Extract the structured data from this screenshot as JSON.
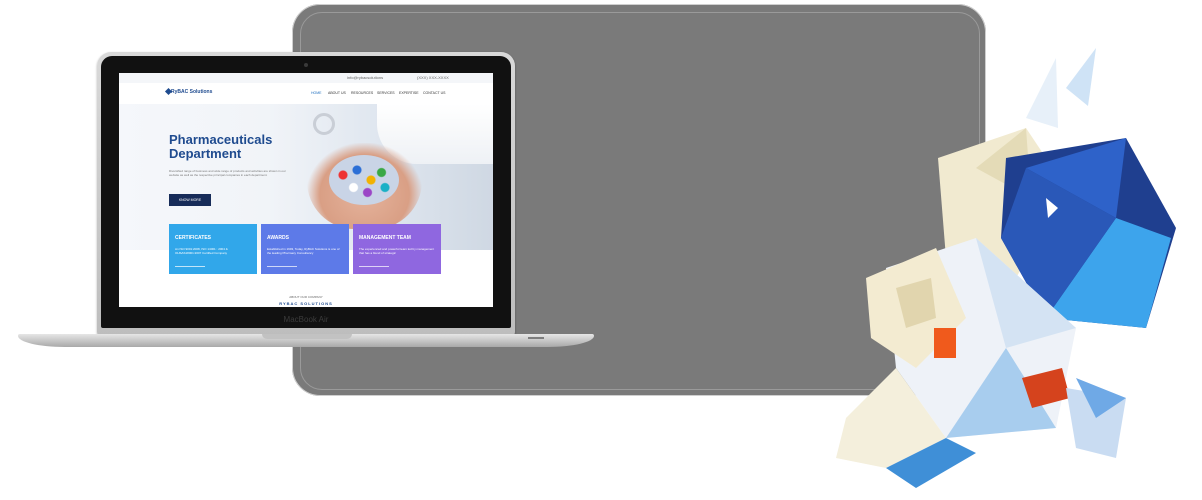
{
  "device": {
    "brand_label": "MacBook Air"
  },
  "website": {
    "topbar": {
      "email": "info@rybacsolutions",
      "phone": "(XXX) XXX-XXXX"
    },
    "logo_text": "RyBAC Solutions",
    "nav": [
      "HOME",
      "ABOUT US",
      "RESOURCES",
      "SERVICES",
      "EXPERTISE",
      "CONTACT US"
    ],
    "hero": {
      "title_line1": "Pharmaceuticals",
      "title_line2": "Department",
      "text": "Diversified range of business and wide range of products and activities are shown in our website as well as the respective principal companies in each department.",
      "button": "KNOW MORE"
    },
    "cards": [
      {
        "title": "CERTIFICATES",
        "body": "An ISO 9001:2008, ISO 14001 : 2004 & OHSAS18001:2007 Certified Company"
      },
      {
        "title": "AWARDS",
        "body": "Established in 1993, Today, RyBAC Solutions is one of the leading Pharmacy Consultancy"
      },
      {
        "title": "MANAGEMENT TEAM",
        "body": "The experienced and powerful team led by management that has a blend of strategic"
      }
    ],
    "about_label": "ABOUT OUR COMPANY",
    "about_heading": "RYBAC SOLUTIONS"
  },
  "colors": {
    "panel": "#7a7a7a",
    "brand_blue": "#1f4b8f",
    "card1": "#31a7ea",
    "card2": "#5d7ae8",
    "card3": "#8f67e0"
  }
}
